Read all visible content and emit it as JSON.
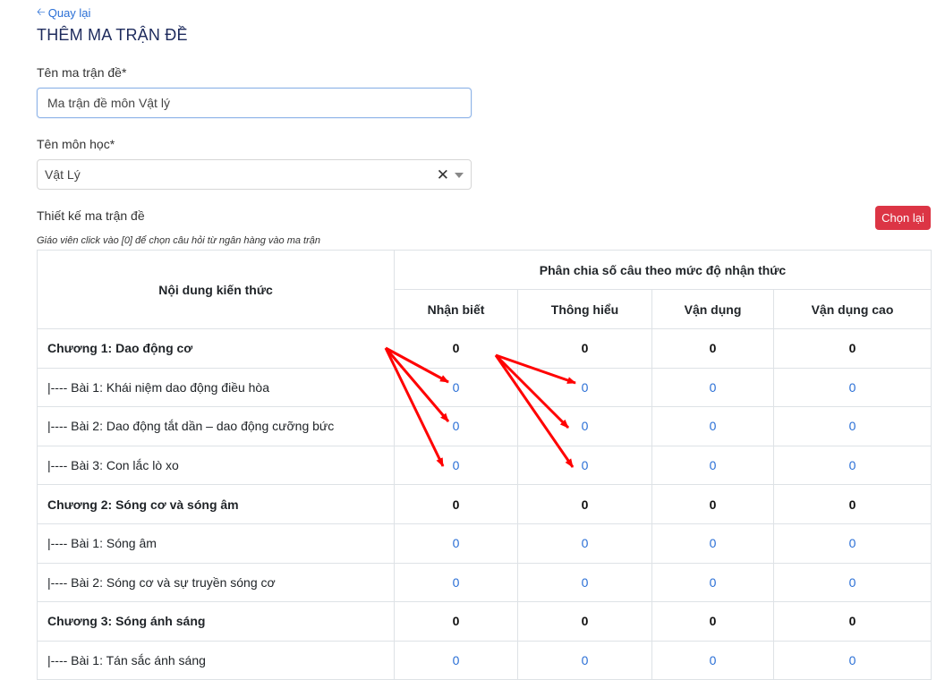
{
  "nav": {
    "back_label": "Quay lại"
  },
  "page": {
    "title": "THÊM MA TRẬN ĐỀ"
  },
  "form": {
    "name_label": "Tên ma trận đề*",
    "name_value": "Ma trận đề môn Vật lý",
    "subject_label": "Tên môn học*",
    "subject_value": "Vật Lý",
    "design_label": "Thiết kế ma trận đề",
    "reset_label": "Chọn lại",
    "hint": "Giáo viên click vào [0] để chọn câu hỏi từ ngân hàng vào ma trận"
  },
  "matrix": {
    "content_header": "Nội dung kiến thức",
    "group_header": "Phân chia số câu theo mức độ nhận thức",
    "levels": [
      "Nhận biết",
      "Thông hiểu",
      "Vận dụng",
      "Vận dụng cao"
    ],
    "rows": [
      {
        "label": "Chương 1: Dao động cơ",
        "values": [
          "0",
          "0",
          "0",
          "0"
        ]
      },
      {
        "label": "|---- Bài 1: Khái niệm dao động điều hòa",
        "values": [
          "0",
          "0",
          "0",
          "0"
        ]
      },
      {
        "label": "|---- Bài 2: Dao động tắt dần – dao động cưỡng bức",
        "values": [
          "0",
          "0",
          "0",
          "0"
        ]
      },
      {
        "label": "|---- Bài 3: Con lắc lò xo",
        "values": [
          "0",
          "0",
          "0",
          "0"
        ]
      },
      {
        "label": "Chương 2: Sóng cơ và sóng âm",
        "values": [
          "0",
          "0",
          "0",
          "0"
        ]
      },
      {
        "label": "|---- Bài 1: Sóng âm",
        "values": [
          "0",
          "0",
          "0",
          "0"
        ]
      },
      {
        "label": "|---- Bài 2: Sóng cơ và sự truyền sóng cơ",
        "values": [
          "0",
          "0",
          "0",
          "0"
        ]
      },
      {
        "label": "Chương 3: Sóng ánh sáng",
        "values": [
          "0",
          "0",
          "0",
          "0"
        ]
      },
      {
        "label": "|---- Bài 1: Tán sắc ánh sáng",
        "values": [
          "0",
          "0",
          "0",
          "0"
        ]
      }
    ]
  },
  "colors": {
    "accent": "#2a6fd6",
    "title": "#1d2a5c",
    "danger": "#dc3545",
    "annotation": "#ff0000"
  }
}
